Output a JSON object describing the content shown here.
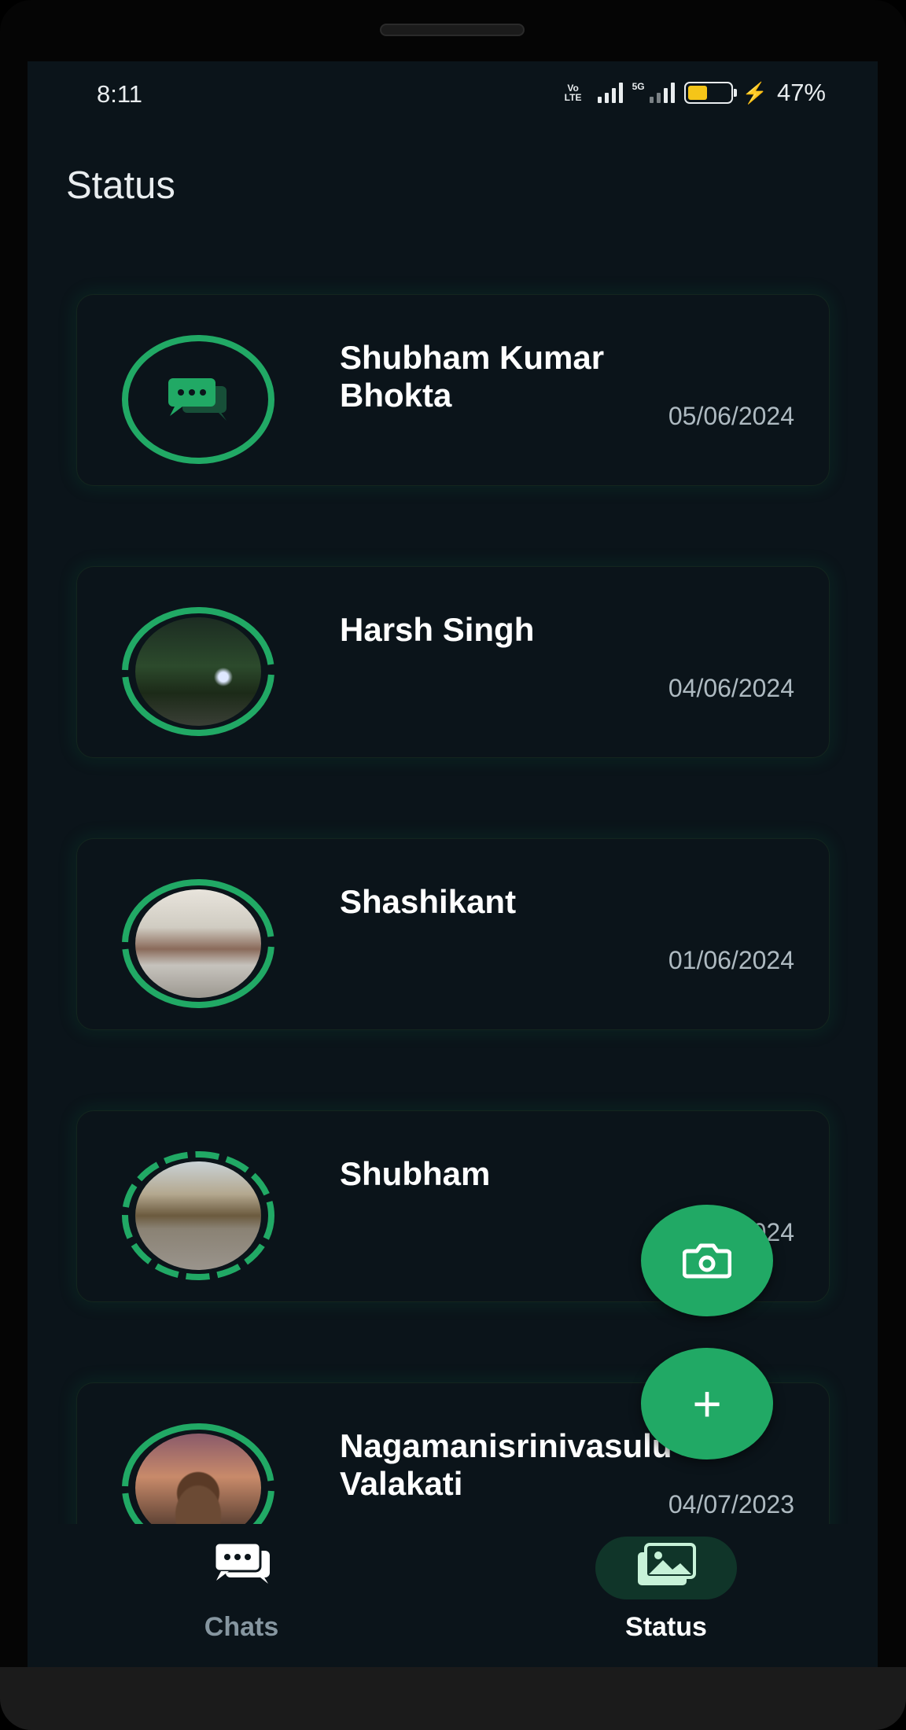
{
  "status_bar": {
    "time": "8:11",
    "network_left": "Vo LTE",
    "network_type": "5G",
    "battery_percent": "47%",
    "battery_level": 0.47
  },
  "header": {
    "title": "Status"
  },
  "statuses": [
    {
      "name": "Shubham Kumar Bhokta",
      "date": "05/06/2024",
      "avatar": "chat-bubbles-icon",
      "ring": "solid"
    },
    {
      "name": "Harsh Singh",
      "date": "04/06/2024",
      "avatar": "photo-night-park",
      "ring": "segmented-2"
    },
    {
      "name": "Shashikant",
      "date": "01/06/2024",
      "avatar": "photo-office-room",
      "ring": "segmented-2"
    },
    {
      "name": "Shubham",
      "date": "04/06/2024",
      "avatar": "photo-road-trees",
      "ring": "segmented-many"
    },
    {
      "name": "Nagamanisrinivasulu Valakati",
      "date": "04/07/2023",
      "avatar": "photo-person-selfie",
      "ring": "segmented-2"
    }
  ],
  "fabs": {
    "camera_icon": "camera-icon",
    "add_icon": "plus-icon",
    "add_label": "+"
  },
  "bottom_nav": {
    "items": [
      {
        "label": "Chats",
        "icon": "chat-bubbles-icon",
        "active": false
      },
      {
        "label": "Status",
        "icon": "gallery-icon",
        "active": true
      }
    ]
  },
  "colors": {
    "background": "#0b141a",
    "accent_green": "#21a965",
    "text_primary": "#ffffff",
    "text_secondary": "#aebac1",
    "active_pill": "#103529"
  }
}
